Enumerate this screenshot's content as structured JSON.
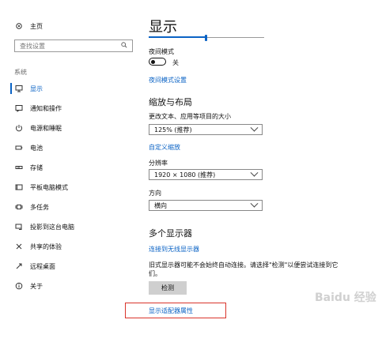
{
  "sidebar": {
    "home": "主页",
    "search_placeholder": "查找设置",
    "group": "系统",
    "items": [
      {
        "label": "显示",
        "icon": "monitor-icon"
      },
      {
        "label": "通知和操作",
        "icon": "message-icon"
      },
      {
        "label": "电源和睡眠",
        "icon": "power-icon"
      },
      {
        "label": "电池",
        "icon": "battery-icon"
      },
      {
        "label": "存储",
        "icon": "storage-icon"
      },
      {
        "label": "平板电脑模式",
        "icon": "tablet-icon"
      },
      {
        "label": "多任务",
        "icon": "multitask-icon"
      },
      {
        "label": "投影到这台电脑",
        "icon": "project-icon"
      },
      {
        "label": "共享的体验",
        "icon": "share-icon"
      },
      {
        "label": "远程桌面",
        "icon": "remote-icon"
      },
      {
        "label": "关于",
        "icon": "info-icon"
      }
    ]
  },
  "main": {
    "title": "显示",
    "brightness_level": 0.49,
    "night_light_label": "夜间模式",
    "night_light_state": "关",
    "night_light_settings_link": "夜间模式设置",
    "scale_section_title": "缩放与布局",
    "scale_label": "更改文本、应用等项目的大小",
    "scale_value": "125% (推荐)",
    "custom_scaling_link": "自定义缩放",
    "resolution_label": "分辨率",
    "resolution_value": "1920 × 1080 (推荐)",
    "orientation_label": "方向",
    "orientation_value": "横向",
    "multi_display_title": "多个显示器",
    "wireless_link": "连接到无线显示器",
    "detect_text": "旧式显示器可能不会始终自动连接。请选择\"检测\"以便尝试连接到它们。",
    "detect_button": "检测",
    "adapter_link": "显示适配器属性"
  },
  "watermark": "Baidu 经验",
  "colors": {
    "accent": "#0b63c5",
    "highlight_box": "#d9342b"
  }
}
